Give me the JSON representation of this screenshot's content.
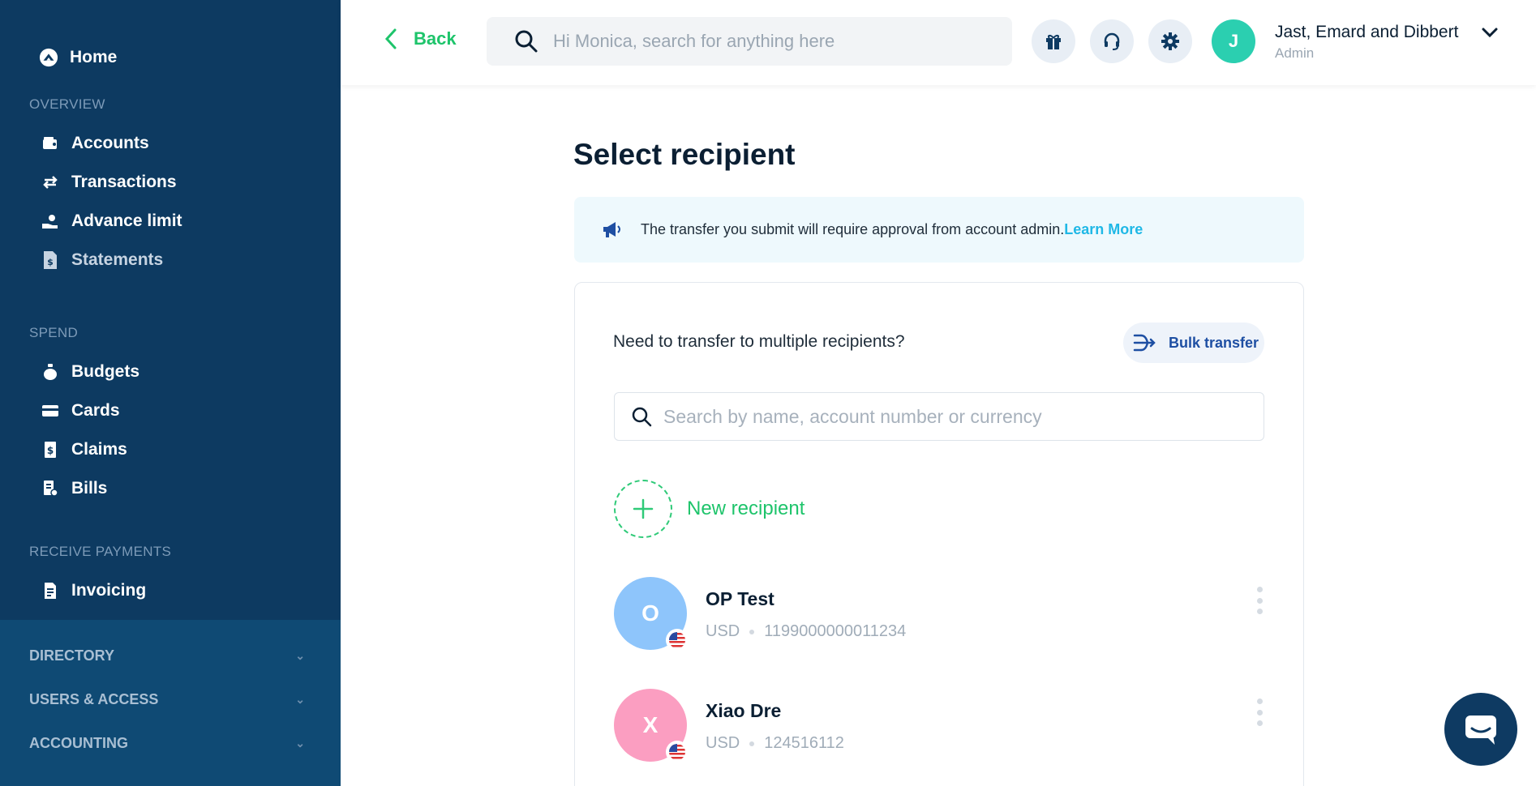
{
  "sidebar": {
    "home_label": "Home",
    "sections": {
      "overview": "OVERVIEW",
      "spend": "SPEND",
      "receive": "RECEIVE PAYMENTS"
    },
    "overview_items": [
      {
        "label": "Accounts",
        "icon": "wallet-icon"
      },
      {
        "label": "Transactions",
        "icon": "swap-arrows-icon"
      },
      {
        "label": "Advance limit",
        "icon": "hand-coin-icon"
      },
      {
        "label": "Statements",
        "icon": "dollar-document-icon"
      }
    ],
    "spend_items": [
      {
        "label": "Budgets",
        "icon": "money-bag-icon"
      },
      {
        "label": "Cards",
        "icon": "card-icon"
      },
      {
        "label": "Claims",
        "icon": "receipt-dollar-icon"
      },
      {
        "label": "Bills",
        "icon": "bill-icon"
      }
    ],
    "receive_items": [
      {
        "label": "Invoicing",
        "icon": "invoice-icon"
      }
    ],
    "groups": [
      {
        "label": "DIRECTORY"
      },
      {
        "label": "USERS & ACCESS"
      },
      {
        "label": "ACCOUNTING"
      }
    ]
  },
  "header": {
    "back_label": "Back",
    "search_placeholder": "Hi Monica, search for anything here",
    "org_name": "Jast, Emard and Dibbert",
    "org_role": "Admin",
    "avatar_initial": "J"
  },
  "main": {
    "title": "Select recipient",
    "notice_text": "The transfer you submit will require approval from account admin.",
    "notice_link": "Learn More",
    "multi_text": "Need to transfer to multiple recipients?",
    "bulk_label": "Bulk transfer",
    "search_placeholder": "Search by name, account number or currency",
    "new_recipient_label": "New recipient",
    "recipients": [
      {
        "initial": "O",
        "name": "OP Test",
        "currency": "USD",
        "account": "1199000000011234",
        "color": "#8ec5fb"
      },
      {
        "initial": "X",
        "name": "Xiao Dre",
        "currency": "USD",
        "account": "124516112",
        "color": "#fb9ec1"
      }
    ]
  },
  "colors": {
    "sidebar": "#0d3a61",
    "accent_green": "#1ec46b",
    "link_blue": "#1fb8e6"
  }
}
